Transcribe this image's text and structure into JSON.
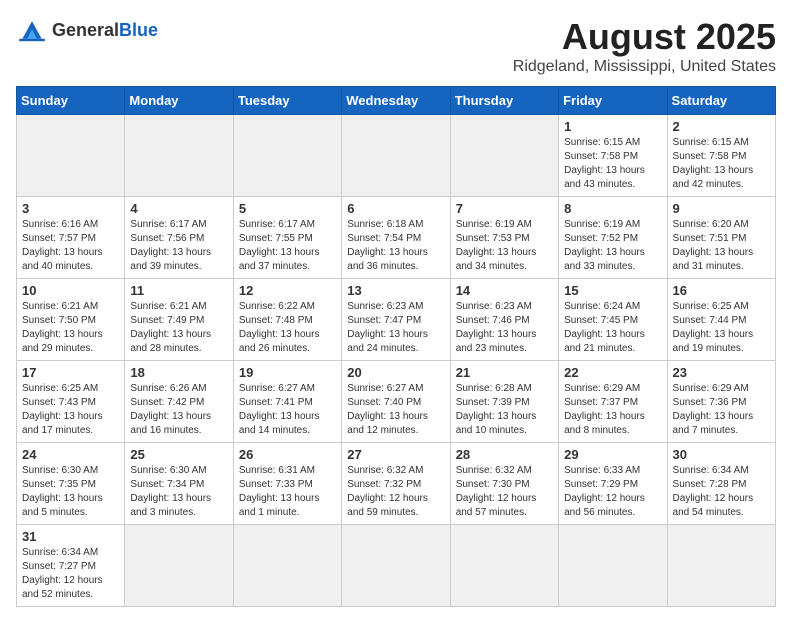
{
  "header": {
    "logo_general": "General",
    "logo_blue": "Blue",
    "title": "August 2025",
    "subtitle": "Ridgeland, Mississippi, United States"
  },
  "days_of_week": [
    "Sunday",
    "Monday",
    "Tuesday",
    "Wednesday",
    "Thursday",
    "Friday",
    "Saturday"
  ],
  "weeks": [
    [
      {
        "day": "",
        "info": "",
        "empty": true
      },
      {
        "day": "",
        "info": "",
        "empty": true
      },
      {
        "day": "",
        "info": "",
        "empty": true
      },
      {
        "day": "",
        "info": "",
        "empty": true
      },
      {
        "day": "",
        "info": "",
        "empty": true
      },
      {
        "day": "1",
        "info": "Sunrise: 6:15 AM\nSunset: 7:58 PM\nDaylight: 13 hours and 43 minutes."
      },
      {
        "day": "2",
        "info": "Sunrise: 6:15 AM\nSunset: 7:58 PM\nDaylight: 13 hours and 42 minutes."
      }
    ],
    [
      {
        "day": "3",
        "info": "Sunrise: 6:16 AM\nSunset: 7:57 PM\nDaylight: 13 hours and 40 minutes."
      },
      {
        "day": "4",
        "info": "Sunrise: 6:17 AM\nSunset: 7:56 PM\nDaylight: 13 hours and 39 minutes."
      },
      {
        "day": "5",
        "info": "Sunrise: 6:17 AM\nSunset: 7:55 PM\nDaylight: 13 hours and 37 minutes."
      },
      {
        "day": "6",
        "info": "Sunrise: 6:18 AM\nSunset: 7:54 PM\nDaylight: 13 hours and 36 minutes."
      },
      {
        "day": "7",
        "info": "Sunrise: 6:19 AM\nSunset: 7:53 PM\nDaylight: 13 hours and 34 minutes."
      },
      {
        "day": "8",
        "info": "Sunrise: 6:19 AM\nSunset: 7:52 PM\nDaylight: 13 hours and 33 minutes."
      },
      {
        "day": "9",
        "info": "Sunrise: 6:20 AM\nSunset: 7:51 PM\nDaylight: 13 hours and 31 minutes."
      }
    ],
    [
      {
        "day": "10",
        "info": "Sunrise: 6:21 AM\nSunset: 7:50 PM\nDaylight: 13 hours and 29 minutes."
      },
      {
        "day": "11",
        "info": "Sunrise: 6:21 AM\nSunset: 7:49 PM\nDaylight: 13 hours and 28 minutes."
      },
      {
        "day": "12",
        "info": "Sunrise: 6:22 AM\nSunset: 7:48 PM\nDaylight: 13 hours and 26 minutes."
      },
      {
        "day": "13",
        "info": "Sunrise: 6:23 AM\nSunset: 7:47 PM\nDaylight: 13 hours and 24 minutes."
      },
      {
        "day": "14",
        "info": "Sunrise: 6:23 AM\nSunset: 7:46 PM\nDaylight: 13 hours and 23 minutes."
      },
      {
        "day": "15",
        "info": "Sunrise: 6:24 AM\nSunset: 7:45 PM\nDaylight: 13 hours and 21 minutes."
      },
      {
        "day": "16",
        "info": "Sunrise: 6:25 AM\nSunset: 7:44 PM\nDaylight: 13 hours and 19 minutes."
      }
    ],
    [
      {
        "day": "17",
        "info": "Sunrise: 6:25 AM\nSunset: 7:43 PM\nDaylight: 13 hours and 17 minutes."
      },
      {
        "day": "18",
        "info": "Sunrise: 6:26 AM\nSunset: 7:42 PM\nDaylight: 13 hours and 16 minutes."
      },
      {
        "day": "19",
        "info": "Sunrise: 6:27 AM\nSunset: 7:41 PM\nDaylight: 13 hours and 14 minutes."
      },
      {
        "day": "20",
        "info": "Sunrise: 6:27 AM\nSunset: 7:40 PM\nDaylight: 13 hours and 12 minutes."
      },
      {
        "day": "21",
        "info": "Sunrise: 6:28 AM\nSunset: 7:39 PM\nDaylight: 13 hours and 10 minutes."
      },
      {
        "day": "22",
        "info": "Sunrise: 6:29 AM\nSunset: 7:37 PM\nDaylight: 13 hours and 8 minutes."
      },
      {
        "day": "23",
        "info": "Sunrise: 6:29 AM\nSunset: 7:36 PM\nDaylight: 13 hours and 7 minutes."
      }
    ],
    [
      {
        "day": "24",
        "info": "Sunrise: 6:30 AM\nSunset: 7:35 PM\nDaylight: 13 hours and 5 minutes."
      },
      {
        "day": "25",
        "info": "Sunrise: 6:30 AM\nSunset: 7:34 PM\nDaylight: 13 hours and 3 minutes."
      },
      {
        "day": "26",
        "info": "Sunrise: 6:31 AM\nSunset: 7:33 PM\nDaylight: 13 hours and 1 minute."
      },
      {
        "day": "27",
        "info": "Sunrise: 6:32 AM\nSunset: 7:32 PM\nDaylight: 12 hours and 59 minutes."
      },
      {
        "day": "28",
        "info": "Sunrise: 6:32 AM\nSunset: 7:30 PM\nDaylight: 12 hours and 57 minutes."
      },
      {
        "day": "29",
        "info": "Sunrise: 6:33 AM\nSunset: 7:29 PM\nDaylight: 12 hours and 56 minutes."
      },
      {
        "day": "30",
        "info": "Sunrise: 6:34 AM\nSunset: 7:28 PM\nDaylight: 12 hours and 54 minutes."
      }
    ],
    [
      {
        "day": "31",
        "info": "Sunrise: 6:34 AM\nSunset: 7:27 PM\nDaylight: 12 hours and 52 minutes."
      },
      {
        "day": "",
        "info": "",
        "empty": true
      },
      {
        "day": "",
        "info": "",
        "empty": true
      },
      {
        "day": "",
        "info": "",
        "empty": true
      },
      {
        "day": "",
        "info": "",
        "empty": true
      },
      {
        "day": "",
        "info": "",
        "empty": true
      },
      {
        "day": "",
        "info": "",
        "empty": true
      }
    ]
  ]
}
